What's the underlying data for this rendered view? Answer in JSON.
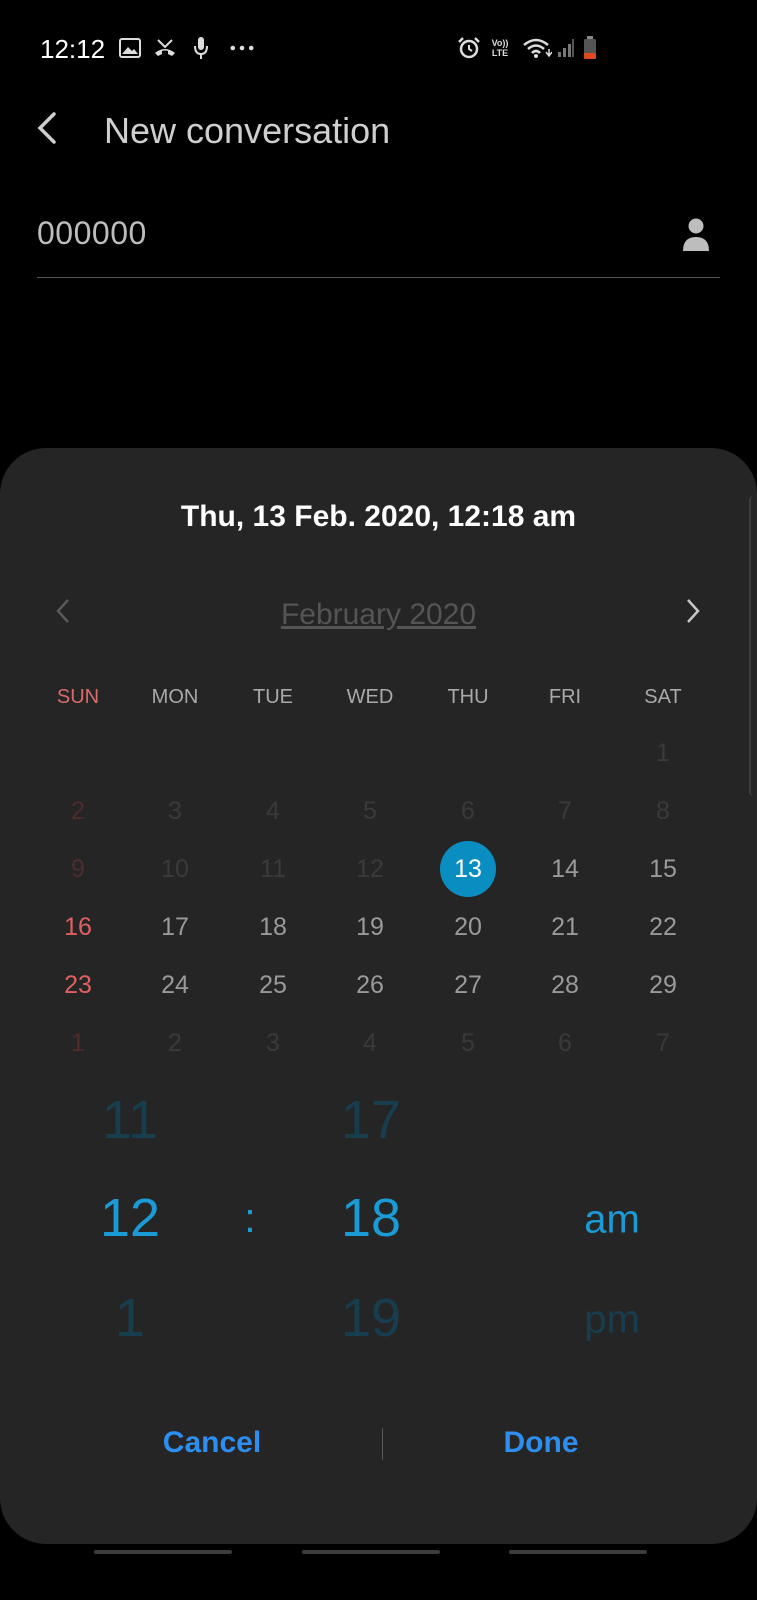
{
  "status_bar": {
    "time": "12:12",
    "left_icons": [
      "image-icon",
      "missed-call-icon",
      "mic-icon",
      "more-dots-icon"
    ],
    "right_icons": [
      "alarm-icon",
      "volte-icon",
      "wifi-icon",
      "signal-icon",
      "battery-icon"
    ],
    "volte_text": "Vo)) LTE"
  },
  "app_bar": {
    "title": "New conversation"
  },
  "recipient": {
    "value": "000000"
  },
  "picker": {
    "selected_datetime": "Thu, 13 Feb. 2020, 12:18 am",
    "month_label": "February 2020",
    "weekdays": [
      "SUN",
      "MON",
      "TUE",
      "WED",
      "THU",
      "FRI",
      "SAT"
    ],
    "weeks": [
      [
        "",
        "",
        "",
        "",
        "",
        "",
        "1"
      ],
      [
        "2",
        "3",
        "4",
        "5",
        "6",
        "7",
        "8"
      ],
      [
        "9",
        "10",
        "11",
        "12",
        "13",
        "14",
        "15"
      ],
      [
        "16",
        "17",
        "18",
        "19",
        "20",
        "21",
        "22"
      ],
      [
        "23",
        "24",
        "25",
        "26",
        "27",
        "28",
        "29"
      ],
      [
        "1",
        "2",
        "3",
        "4",
        "5",
        "6",
        "7"
      ]
    ],
    "selected_day": "13",
    "hours": {
      "prev": "11",
      "current": "12",
      "next": "1"
    },
    "minutes": {
      "prev": "17",
      "current": "18",
      "next": "19"
    },
    "ampm": {
      "current": "am",
      "next": "pm"
    },
    "separator": ":",
    "cancel_label": "Cancel",
    "done_label": "Done"
  },
  "colors": {
    "accent": "#1a9bd6",
    "selected_day": "#0a8ec2",
    "button": "#2d8ef0",
    "sunday": "#e06060",
    "sheet_bg": "#252525"
  }
}
